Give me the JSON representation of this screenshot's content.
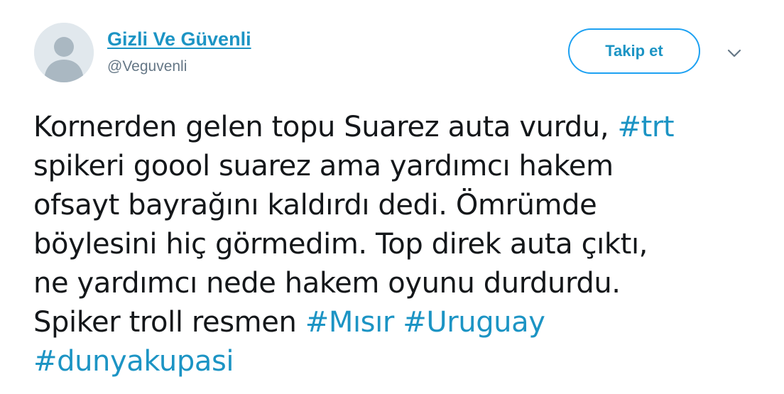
{
  "user": {
    "name": "Gizli Ve Güvenli",
    "handle": "@Veguvenli",
    "avatar_icon": "default-profile-icon"
  },
  "actions": {
    "follow_label": "Takip et",
    "more_icon": "chevron-down-icon"
  },
  "tweet": {
    "line1": {
      "text": "Kornerden gelen topu Suarez auta vurdu, ",
      "hashtag": "#trt"
    },
    "line2": {
      "text": "spikeri goool suarez ama yardımcı hakem"
    },
    "line3": {
      "text": "ofsayt bayrağını kaldırdı dedi. Ömrümde"
    },
    "line4": {
      "text": "böylesini hiç görmedim. Top direk auta çıktı,"
    },
    "line5": {
      "text": "ne yardımcı nede hakem oyunu durdurdu."
    },
    "line6": {
      "text": "Spiker troll resmen ",
      "hashtag_1": "#Mısır",
      "hashtag_2": "#Uruguay"
    },
    "line7": {
      "hashtag": "#dunyakupasi"
    }
  },
  "colors": {
    "link": "#1c94c4",
    "text": "#14171a",
    "secondary": "#657786",
    "button_border": "#1da1f2",
    "avatar_bg": "#e1e8ed",
    "avatar_fg": "#aab8c2"
  }
}
